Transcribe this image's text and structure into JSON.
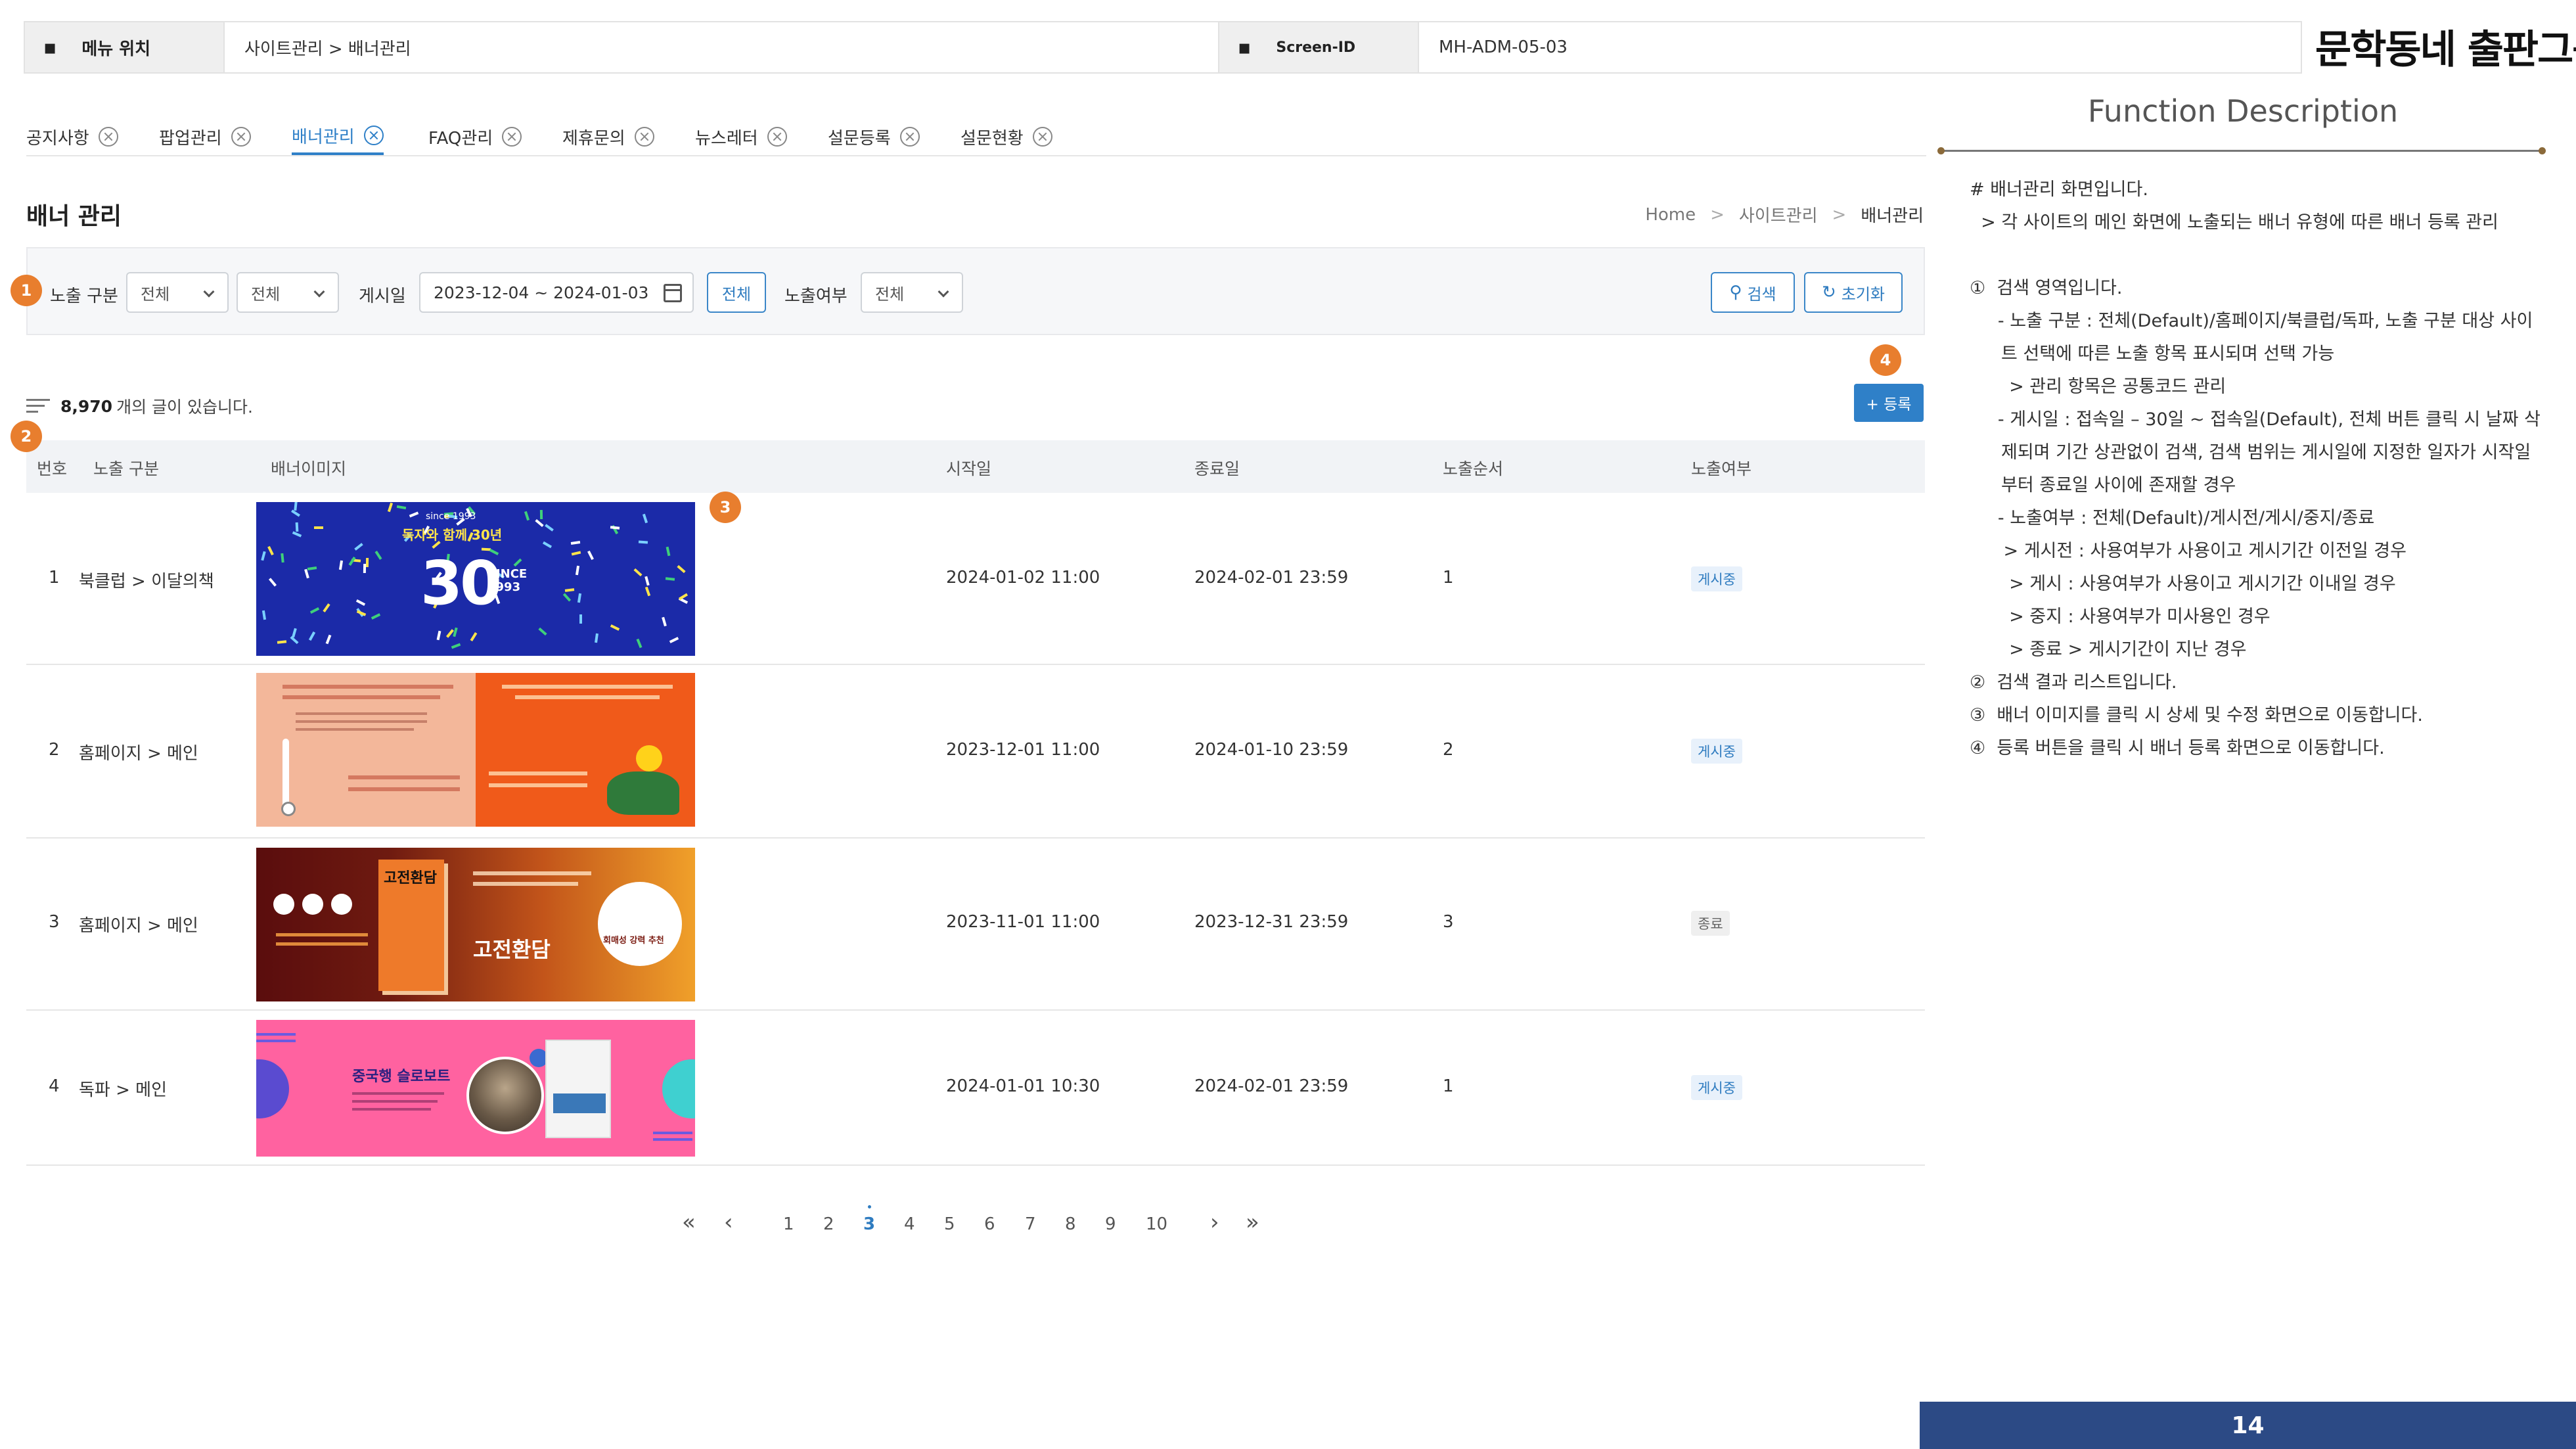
{
  "header": {
    "menu_label": "메뉴 위치",
    "menu_value": "사이트관리 > 배너관리",
    "screen_label": "Screen-ID",
    "screen_value": "MH-ADM-05-03",
    "logo": "문학동네 출판그룹"
  },
  "tabs": [
    {
      "label": "공지사항"
    },
    {
      "label": "팝업관리"
    },
    {
      "label": "배너관리",
      "active": true
    },
    {
      "label": "FAQ관리"
    },
    {
      "label": "제휴문의"
    },
    {
      "label": "뉴스레터"
    },
    {
      "label": "설문등록"
    },
    {
      "label": "설문현황"
    }
  ],
  "page": {
    "title": "배너 관리",
    "breadcrumb": [
      "Home",
      "사이트관리",
      "배너관리"
    ]
  },
  "search": {
    "exposure_label": "노출 구분",
    "exposure_select1": "전체",
    "exposure_select2": "전체",
    "date_label": "게시일",
    "date_range": "2023-12-04 ~ 2024-01-03",
    "all_button": "전체",
    "visibility_label": "노출여부",
    "visibility_select": "전체",
    "search_button": "검색",
    "reset_button": "초기화"
  },
  "markers": [
    "1",
    "2",
    "3",
    "4"
  ],
  "list": {
    "count": "8,970",
    "count_suffix": "개의 글이 있습니다.",
    "register_button": "+ 등록"
  },
  "table": {
    "headers": [
      "번호",
      "노출 구분",
      "배너이미지",
      "시작일",
      "종료일",
      "노출순서",
      "노출여부"
    ],
    "rows": [
      {
        "no": "1",
        "category": "북클럽 > 이달의책",
        "start": "2024-01-02 11:00",
        "end": "2024-02-01 23:59",
        "order": "1",
        "status": "게시중",
        "status_type": "on"
      },
      {
        "no": "2",
        "category": "홈페이지 > 메인",
        "start": "2023-12-01 11:00",
        "end": "2024-01-10 23:59",
        "order": "2",
        "status": "게시중",
        "status_type": "on"
      },
      {
        "no": "3",
        "category": "홈페이지 > 메인",
        "start": "2023-11-01 11:00",
        "end": "2023-12-31 23:59",
        "order": "3",
        "status": "종료",
        "status_type": "off"
      },
      {
        "no": "4",
        "category": "독파 > 메인",
        "start": "2024-01-01 10:30",
        "end": "2024-02-01 23:59",
        "order": "1",
        "status": "게시중",
        "status_type": "on"
      }
    ]
  },
  "banners": {
    "b1_since": "since 1993",
    "b1_headline": "독자와 함께 30년",
    "b1_big": "30",
    "b1_side": "SINCE 1993",
    "b3_title": "고전환담",
    "b3_sub": "회매성 강력 추천",
    "b4_title": "중국행 슬로보트"
  },
  "pagination": {
    "pages": [
      "1",
      "2",
      "3",
      "4",
      "5",
      "6",
      "7",
      "8",
      "9",
      "10"
    ],
    "current": "3"
  },
  "function_description": {
    "title": "Function Description",
    "lines": [
      "# 배너관리 화면입니다.",
      "  > 각 사이트의 메인 화면에 노출되는 배너 유형에 따른 배너 등록 관리",
      "",
      "①  검색 영역입니다.",
      "     - 노출 구분 : 전체(Default)/홈페이지/북클럽/독파, 노출 구분 대상 사이트 선택에 따른 노출 항목 표시되며 선택 가능",
      "       > 관리 항목은 공통코드 관리",
      "     - 게시일 : 접속일 – 30일 ~ 접속일(Default), 전체 버튼 클릭 시 날짜 삭제되며 기간 상관없이 검색, 검색 범위는 게시일에 지정한 일자가 시작일부터 종료일 사이에 존재할 경우",
      "     - 노출여부 : 전체(Default)/게시전/게시/중지/종료",
      "      > 게시전 : 사용여부가 사용이고 게시기간 이전일 경우",
      "       > 게시 : 사용여부가 사용이고 게시기간 이내일 경우",
      "       > 중지 : 사용여부가 미사용인 경우",
      "       > 종료 > 게시기간이 지난 경우",
      "②  검색 결과 리스트입니다.",
      "③  배너 이미지를 클릭 시 상세 및 수정 화면으로 이동합니다.",
      "④  등록 버튼을 클릭 시 배너 등록 화면으로 이동합니다."
    ]
  },
  "page_number": "14",
  "colors": {
    "accent": "#2f80c8",
    "marker": "#e87e2e",
    "footer": "#2c4a85"
  }
}
